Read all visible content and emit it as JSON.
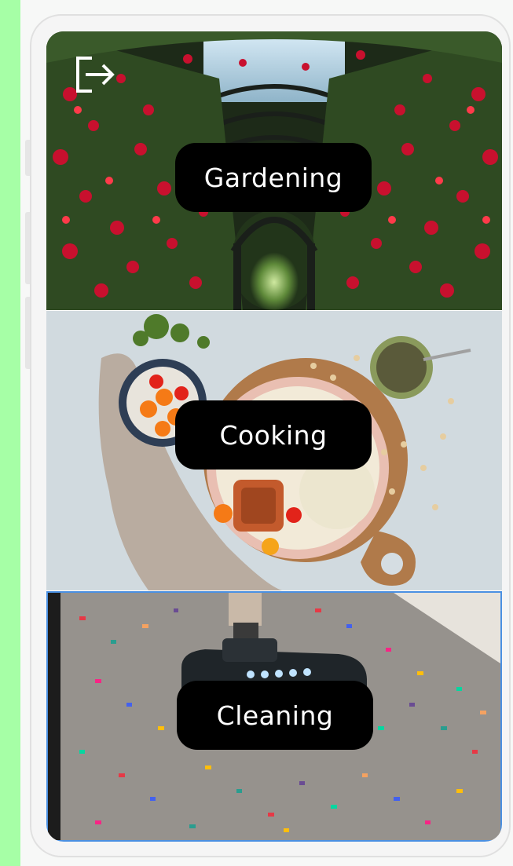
{
  "screen": {
    "logout_icon": "logout-icon",
    "categories": [
      {
        "label": "Gardening",
        "image": "rose-arch-garden"
      },
      {
        "label": "Cooking",
        "image": "food-bowl-table"
      },
      {
        "label": "Cleaning",
        "image": "vacuum-confetti-carpet"
      }
    ]
  },
  "colors": {
    "background": "#a6ffa6",
    "pill": "#000000",
    "pill_text": "#ffffff",
    "selection_border": "#4a90e2"
  }
}
